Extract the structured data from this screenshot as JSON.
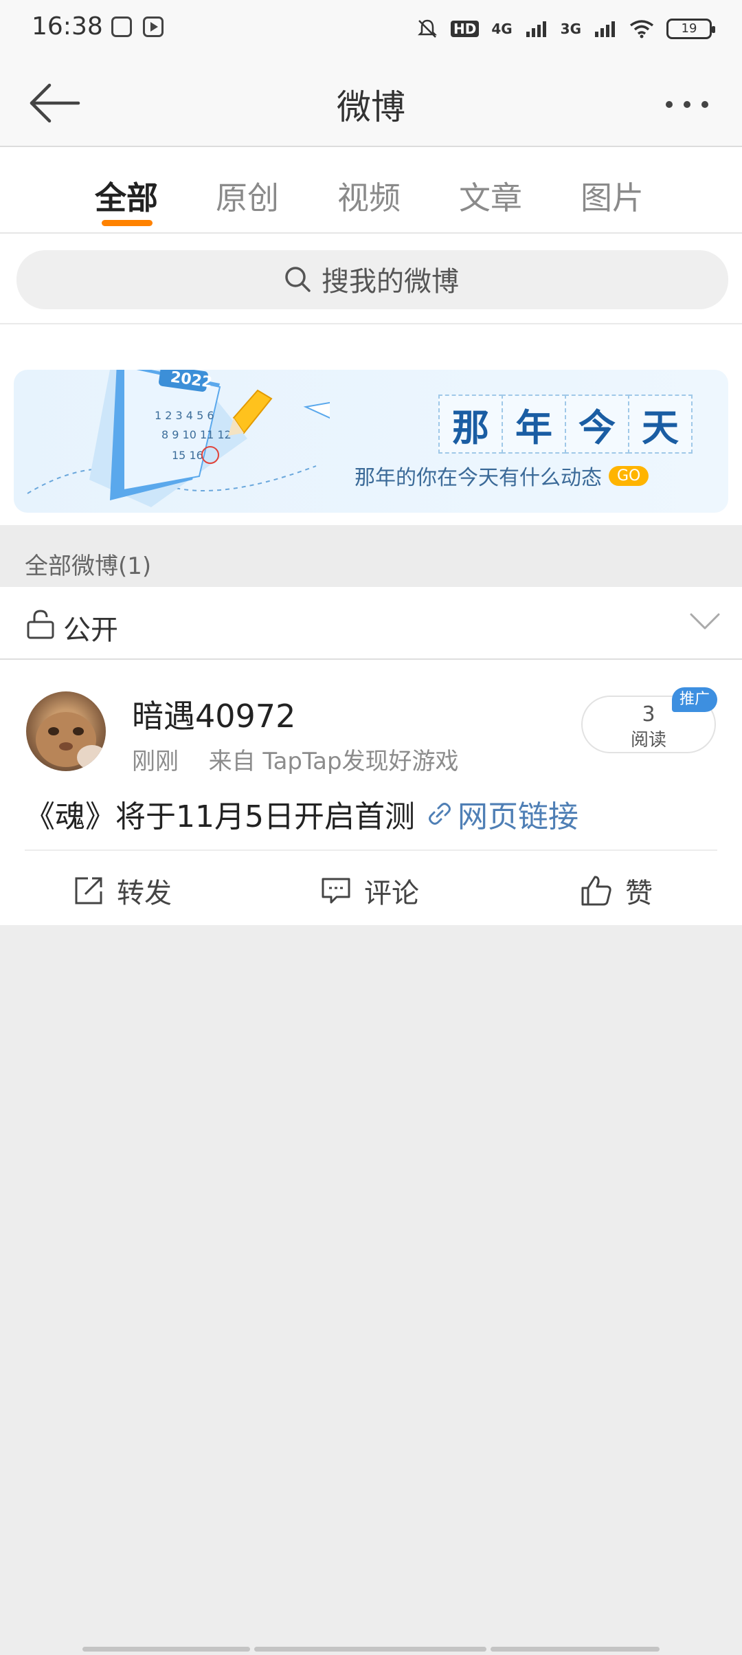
{
  "status_bar": {
    "time": "16:38",
    "network_1": "4G",
    "network_2": "3G",
    "battery": "19",
    "hd_label": "HD"
  },
  "header": {
    "title": "微博",
    "back_icon": "arrow-left-icon",
    "more_icon": "more-dots-icon"
  },
  "tabs": [
    {
      "label": "全部",
      "active": true
    },
    {
      "label": "原创",
      "active": false
    },
    {
      "label": "视频",
      "active": false
    },
    {
      "label": "文章",
      "active": false
    },
    {
      "label": "图片",
      "active": false
    }
  ],
  "search": {
    "placeholder": "搜我的微博"
  },
  "banner": {
    "title_chars": [
      "那",
      "年",
      "今",
      "天"
    ],
    "subtitle": "那年的你在今天有什么动态",
    "go_label": "GO",
    "calendar_year": "2022"
  },
  "section": {
    "label": "全部微博(1)"
  },
  "privacy": {
    "label": "公开"
  },
  "post": {
    "username": "暗遇40972",
    "time": "刚刚",
    "source": "来自 TapTap发现好游戏",
    "read_count": "3",
    "read_label": "阅读",
    "promo_tag": "推广",
    "text": "《魂》将于11月5日开启首测",
    "link_label": "网页链接",
    "actions": {
      "repost": "转发",
      "comment": "评论",
      "like": "赞"
    }
  },
  "colors": {
    "accent": "#ff8200",
    "link": "#4f7fb5",
    "banner_title": "#1a5da3",
    "promo": "#3d8fe0"
  }
}
